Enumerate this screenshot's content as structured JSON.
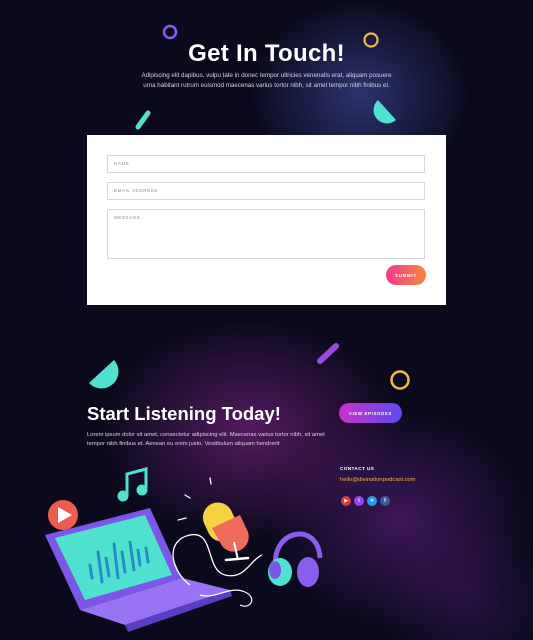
{
  "contact_section": {
    "title": "Get In Touch!",
    "text": "Adipiscing elit dapibus, vulpu tate in donec tempor ultricies venenatis erat, aliquam posuere urna habitant rutrum euismod maecenas varius tortor nibh, sit amet tempor nibh finibus et.",
    "form": {
      "name_placeholder": "NAME",
      "email_placeholder": "EMAIL ADDRESS",
      "message_placeholder": "MESSAGE",
      "submit_label": "SUBMIT"
    }
  },
  "listen_section": {
    "title": "Start Listening Today!",
    "text": "Lorem ipsum dolor sit amet, consectetur adipiscing elit. Maecenas varius tortor nibh, sit amet tempor nibh finibus et. Aenean eu enim justo. Vestibulum aliquam hendrerit",
    "episodes_button": "VIEW EPISODES",
    "contact_label": "CONTACT US",
    "contact_email": "hello@divinationpodcast.com",
    "social_icons": [
      {
        "name": "youtube-icon",
        "color": "#e03b3b",
        "glyph": "▶"
      },
      {
        "name": "twitch-icon",
        "color": "#9146ff",
        "glyph": "t"
      },
      {
        "name": "twitter-icon",
        "color": "#1da1f2",
        "glyph": "✦"
      },
      {
        "name": "facebook-icon",
        "color": "#3b5998",
        "glyph": "f"
      }
    ]
  },
  "colors": {
    "background": "#0b0a1c",
    "accent_cyan": "#4fe3cf",
    "accent_purple": "#8a5cf0",
    "accent_gold": "#f6b63c",
    "accent_pink": "#ee3c8f"
  }
}
